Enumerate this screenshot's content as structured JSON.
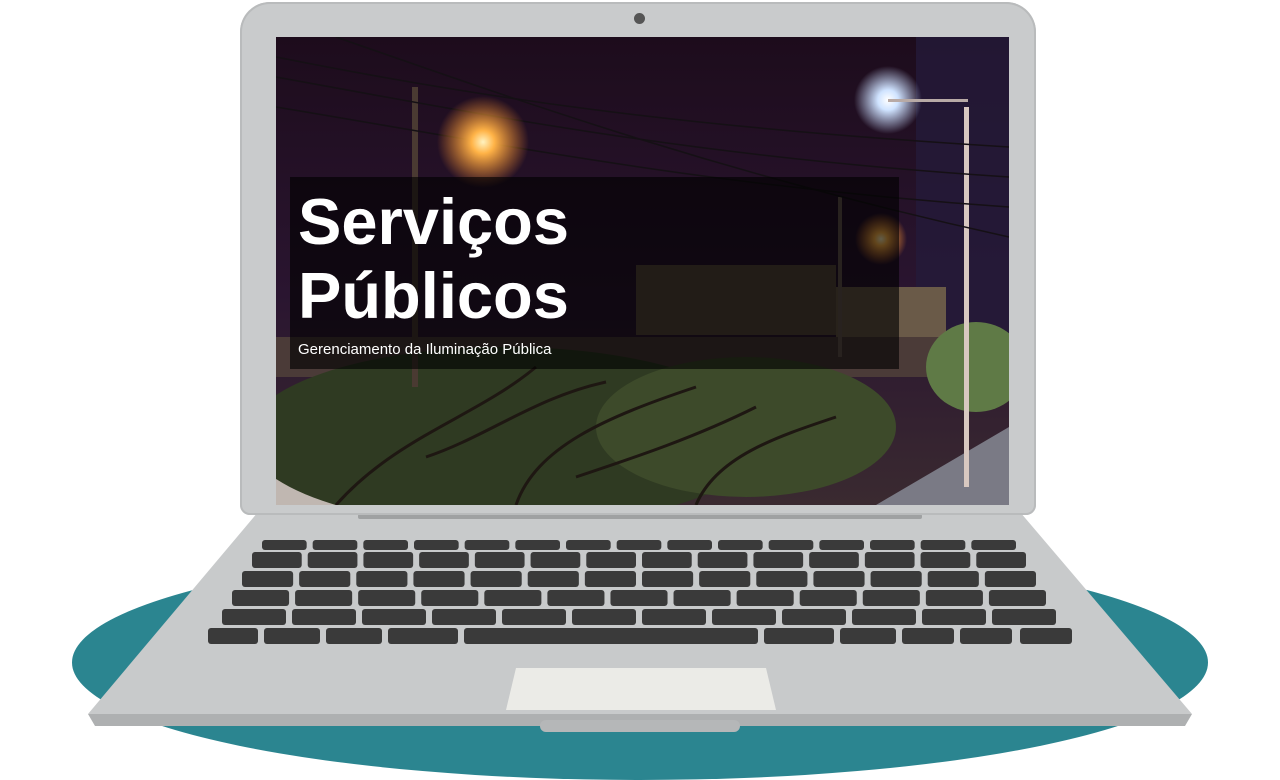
{
  "hero": {
    "title": "Serviços\nPúblicos",
    "subtitle": "Gerenciamento da Iluminação Pública"
  },
  "icons": {
    "webcam": "webcam-dot",
    "scene": "night-street-lamp-photo"
  },
  "colors": {
    "platform": "#2b8590",
    "laptop_body": "#c9cbcc",
    "keys": "#3a3a3a",
    "overlay": "rgba(0,0,0,0.62)",
    "text": "#ffffff"
  }
}
